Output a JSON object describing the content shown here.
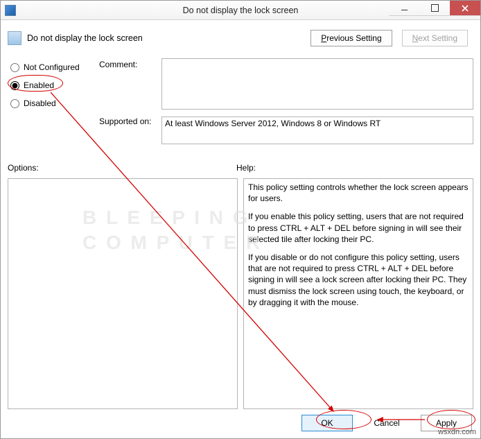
{
  "window": {
    "title": "Do not display the lock screen",
    "controls": {
      "min": "minimize",
      "max": "maximize",
      "close": "close"
    }
  },
  "header": {
    "policy_title": "Do not display the lock screen"
  },
  "nav": {
    "previous": "Previous Setting",
    "next": "Next Setting"
  },
  "radios": {
    "not_configured": "Not Configured",
    "enabled": "Enabled",
    "disabled": "Disabled",
    "selected": "enabled"
  },
  "labels": {
    "comment": "Comment:",
    "supported_on": "Supported on:",
    "options": "Options:",
    "help": "Help:"
  },
  "comment_value": "",
  "supported_value": "At least Windows Server 2012, Windows 8 or Windows RT",
  "options_value": "",
  "help": {
    "p1": "This policy setting controls whether the lock screen appears for users.",
    "p2": "If you enable this policy setting, users that are not required to press CTRL + ALT + DEL before signing in will see their selected tile after  locking their PC.",
    "p3": "If you disable or do not configure this policy setting, users that are not required to press CTRL + ALT + DEL before signing in will see a lock screen after locking their PC. They must dismiss the lock screen using touch, the keyboard, or by dragging it with the mouse."
  },
  "footer": {
    "ok": "OK",
    "cancel": "Cancel",
    "apply": "Apply"
  },
  "watermark_line1": "B L E E P I N G",
  "watermark_line2": "C O M P U T E R",
  "source_mark": "wsxdn.com"
}
